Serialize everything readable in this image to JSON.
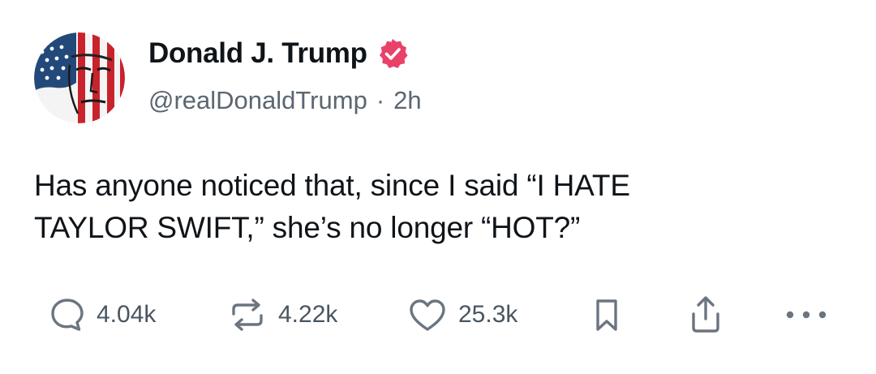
{
  "author": {
    "display_name": "Donald J. Trump",
    "handle": "@realDonaldTrump",
    "separator": "·",
    "timestamp": "2h",
    "verified": true,
    "verified_color": "#e8426a"
  },
  "post": {
    "text_line1": "Has anyone noticed that, since I said “I HATE",
    "text_line2": "TAYLOR SWIFT,” she’s no longer “HOT?”"
  },
  "actions": {
    "reply": {
      "icon": "reply-icon",
      "count": "4.04k"
    },
    "repost": {
      "icon": "repost-icon",
      "count": "4.22k"
    },
    "like": {
      "icon": "heart-icon",
      "count": "25.3k"
    },
    "bookmark": {
      "icon": "bookmark-icon"
    },
    "share": {
      "icon": "share-icon"
    },
    "more": {
      "icon": "more-icon"
    }
  },
  "colors": {
    "text_primary": "#0f1419",
    "text_secondary": "#5b6670",
    "icon_gray": "#6b7580"
  }
}
